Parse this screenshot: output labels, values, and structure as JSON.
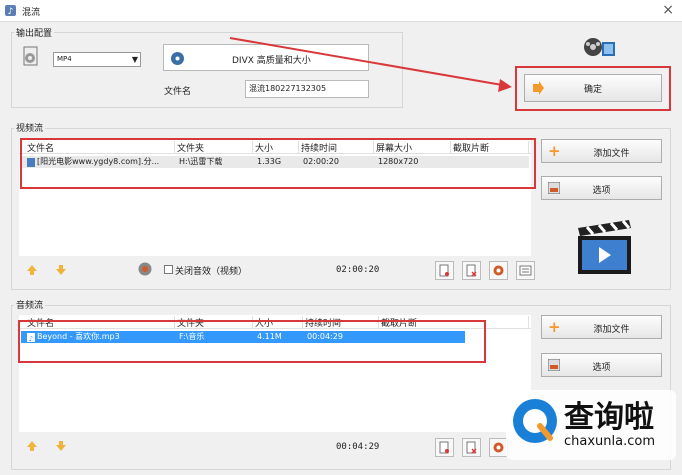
{
  "window": {
    "title": "混流",
    "close_glyph": "×"
  },
  "output": {
    "group_label": "输出配置",
    "format_value": "MP4",
    "profile_label": "DIVX 高质量和大小",
    "filename_label": "文件名",
    "filename_value": "混流180227132305",
    "confirm_label": "确定"
  },
  "video": {
    "group_label": "视频流",
    "columns": [
      "文件名",
      "文件夹",
      "大小",
      "持续时间",
      "屏幕大小",
      "截取片断"
    ],
    "rows": [
      {
        "name": "[阳光电影www.ygdy8.com].分...",
        "folder": "H:\\迅雷下载",
        "size": "1.33G",
        "duration": "02:00:20",
        "screen": "1280x720"
      }
    ],
    "add_file_label": "添加文件",
    "options_label": "选项",
    "mute_label": "关闭音效（视频）",
    "total_time": "02:00:20"
  },
  "audio": {
    "group_label": "音频流",
    "columns": [
      "文件名",
      "文件夹",
      "大小",
      "持续时间",
      "截取片断"
    ],
    "rows": [
      {
        "name": "Beyond - 喜欢你.mp3",
        "folder": "F:\\音乐",
        "size": "4.11M",
        "duration": "00:04:29"
      }
    ],
    "add_file_label": "添加文件",
    "options_label": "选项",
    "total_time": "00:04:29"
  },
  "watermark": {
    "brand": "查询啦",
    "url": "chaxunla.com"
  },
  "colors": {
    "highlight_red": "#d9383a",
    "selection_blue": "#3399ff",
    "brand_blue": "#1a7fd6"
  }
}
